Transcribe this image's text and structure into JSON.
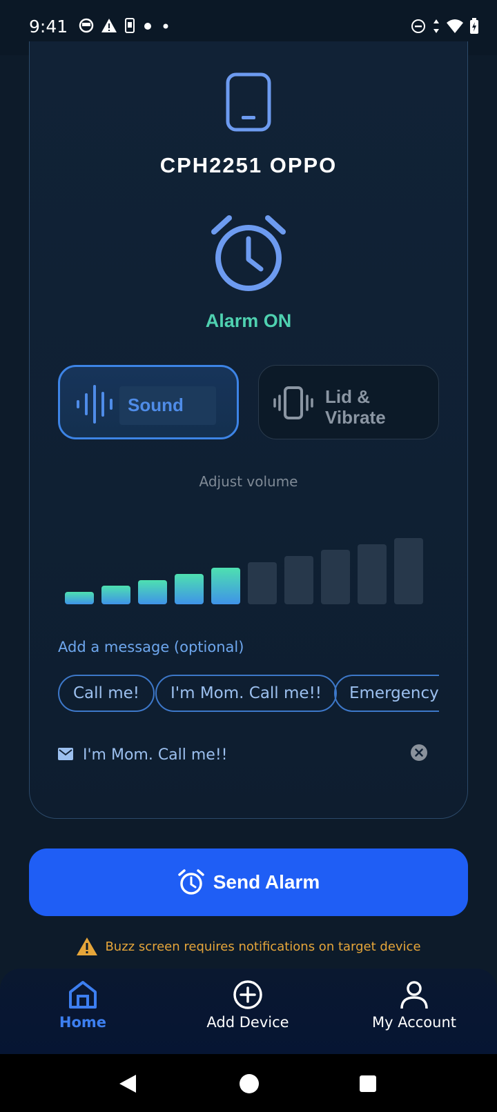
{
  "status_bar": {
    "time": "9:41",
    "left_icons": [
      "app-icon",
      "warning-icon",
      "sim-icon",
      "dot-icon",
      "dot-icon"
    ],
    "right_icons": [
      "dnd-icon",
      "data-arrows-icon",
      "wifi-icon",
      "battery-charging-icon"
    ]
  },
  "device": {
    "icon": "phone-icon",
    "name": "CPH2251 OPPO"
  },
  "alarm": {
    "icon": "alarm-clock-icon",
    "status": "Alarm ON",
    "status_color": "#4fd1b0"
  },
  "modes": [
    {
      "label": "Sound",
      "icon": "sound-wave-icon",
      "selected": true
    },
    {
      "label": "Lid & Vibrate",
      "icon": "vibrate-icon",
      "selected": false
    }
  ],
  "volume": {
    "label": "Adjust volume",
    "level": 5,
    "max": 10
  },
  "message": {
    "label": "Add a message (optional)",
    "chips": [
      "Call me!",
      "I'm Mom. Call me!!",
      "Emergency!"
    ],
    "value": "I'm Mom. Call me!!"
  },
  "send_button": {
    "label": "Send Alarm",
    "icon": "alarm-clock-icon",
    "color": "#1f5ef5"
  },
  "warning": {
    "text": "Buzz screen requires notifications on target device",
    "color": "#e6a63a"
  },
  "bottom_nav": [
    {
      "label": "Home",
      "icon": "home-icon",
      "active": true
    },
    {
      "label": "Add Device",
      "icon": "plus-circle-icon",
      "active": false
    },
    {
      "label": "My Account",
      "icon": "user-icon",
      "active": false
    }
  ],
  "accent_color": "#3d84e6"
}
